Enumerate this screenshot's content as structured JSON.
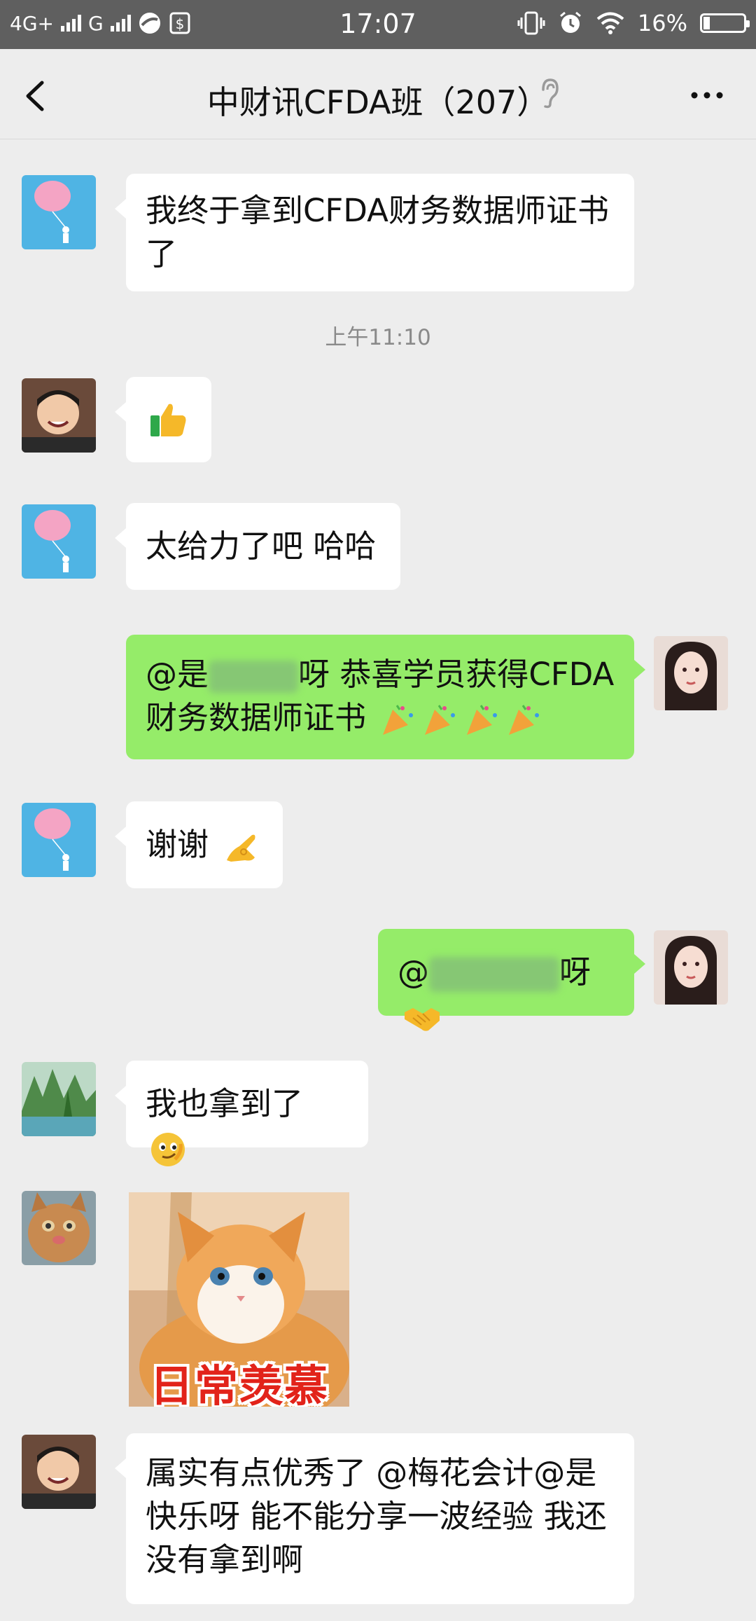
{
  "status_bar": {
    "network1": "4G+",
    "network2": "G",
    "time": "17:07",
    "battery": "16%",
    "battery_level": 0.16
  },
  "chat": {
    "title": "中财讯CFDA班（207）"
  },
  "messages": [
    {
      "text": "我终于拿到CFDA财务数据师证书了"
    },
    {
      "time": "上午11:10"
    },
    {
      "emoji": "thumbs-up-icon"
    },
    {
      "text": "太给力了吧 哈哈"
    },
    {
      "text_a": "@是",
      "text_b": "呀 恭喜学员获得CFDA",
      "text_c": "财务数据师证书",
      "emoji": "party-popper-icon"
    },
    {
      "text": "谢谢",
      "emoji": "ok-hand-icon"
    },
    {
      "text_a": "@",
      "text_b": "呀",
      "emoji": "handshake-icon"
    },
    {
      "text": "我也拿到了",
      "emoji": "smirk-face-icon"
    },
    {
      "sticker_caption": "日常羡慕"
    },
    {
      "text": "属实有点优秀了 @梅花会计@是快乐呀 能不能分享一波经验 我还没有拿到啊"
    }
  ],
  "colors": {
    "background": "#ededed",
    "outgoing_bubble": "#95ec69",
    "incoming_bubble": "#ffffff",
    "status_bar": "#5f5f5f"
  }
}
